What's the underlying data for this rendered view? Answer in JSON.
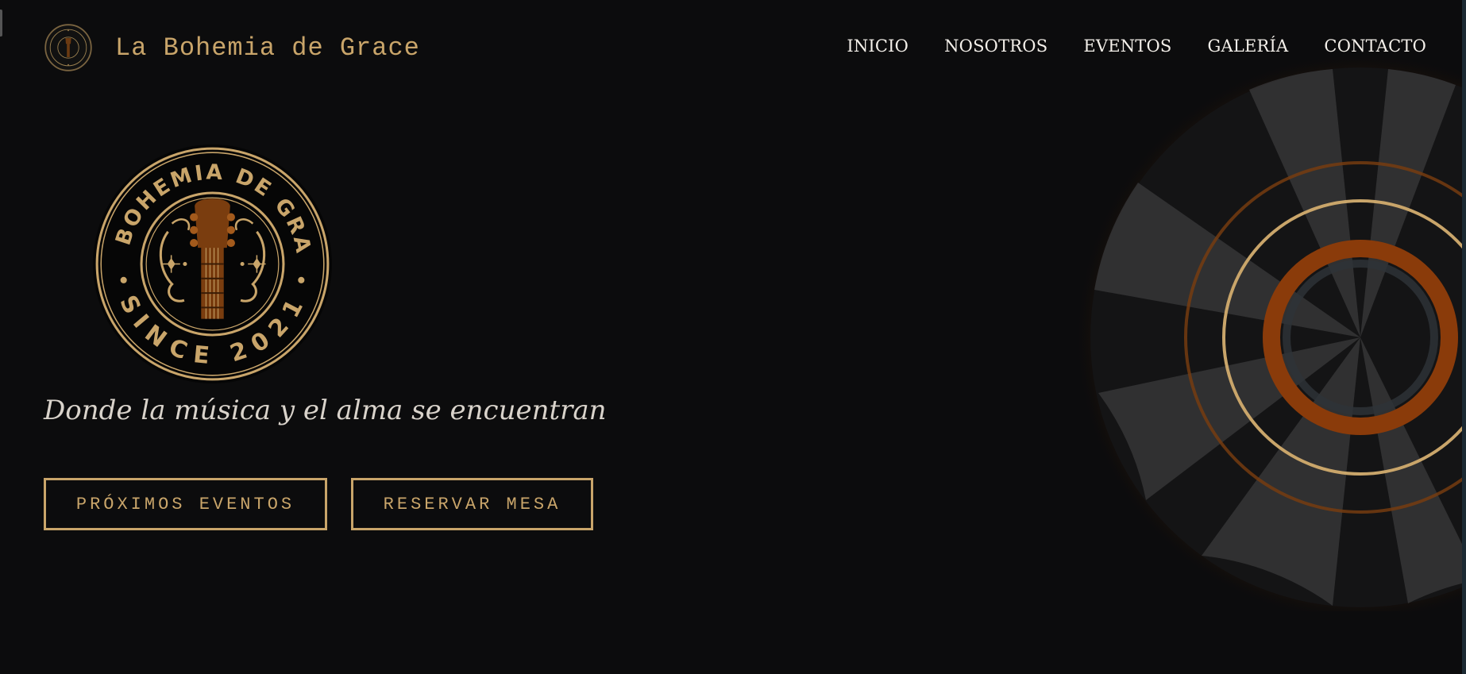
{
  "site": {
    "name": "La Bohemia de Grace",
    "emblem_top_text": "LA BOHEMIA DE GRACE",
    "emblem_bottom_text": "SINCE 2021"
  },
  "nav": {
    "items": [
      {
        "label": "INICIO"
      },
      {
        "label": "NOSOTROS"
      },
      {
        "label": "EVENTOS"
      },
      {
        "label": "GALERÍA"
      },
      {
        "label": "CONTACTO"
      }
    ]
  },
  "hero": {
    "tagline": "Donde la música y el alma se encuentran",
    "buttons": {
      "events": "PRÓXIMOS EVENTOS",
      "reserve": "RESERVAR MESA"
    }
  },
  "colors": {
    "background": "#0c0c0d",
    "gold": "#c9a56a",
    "amber": "#8a3b0a",
    "nav_text": "#f4f0ea"
  },
  "icons": {
    "brand": "guitar-emblem-icon",
    "decoration": "vinyl-record-icon"
  }
}
